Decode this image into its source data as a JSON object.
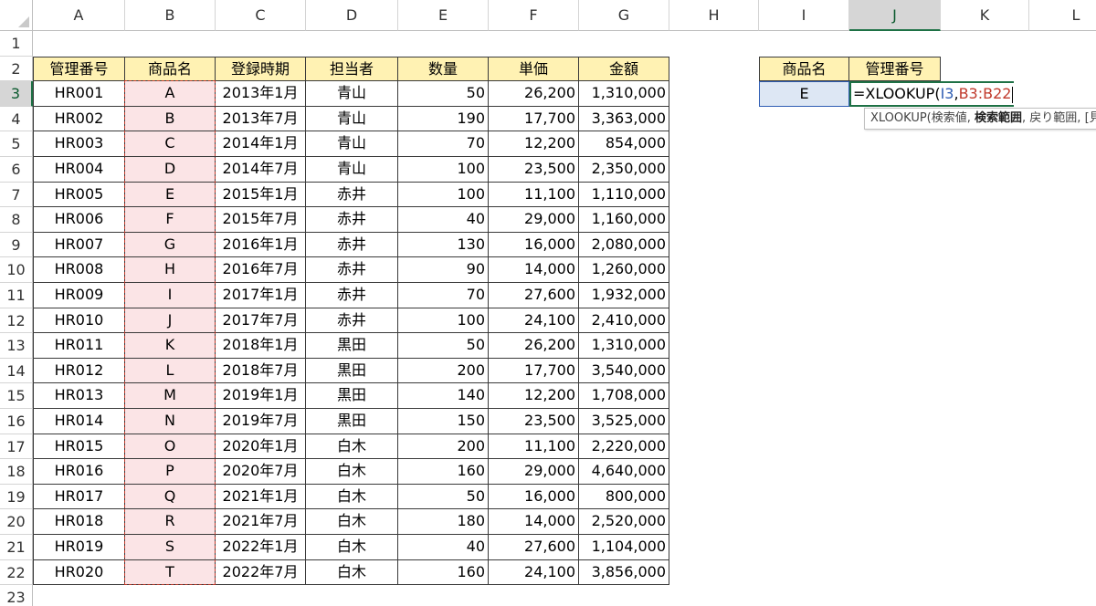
{
  "columns": [
    "A",
    "B",
    "C",
    "D",
    "E",
    "F",
    "G",
    "H",
    "I",
    "J",
    "K",
    "L"
  ],
  "rows": [
    "1",
    "2",
    "3",
    "4",
    "5",
    "6",
    "7",
    "8",
    "9",
    "10",
    "11",
    "12",
    "13",
    "14",
    "15",
    "16",
    "17",
    "18",
    "19",
    "20",
    "21",
    "22",
    "23"
  ],
  "selected_column": "J",
  "selected_row": "3",
  "table": {
    "headers": [
      "管理番号",
      "商品名",
      "登録時期",
      "担当者",
      "数量",
      "単価",
      "金額"
    ],
    "rows": [
      [
        "HR001",
        "A",
        "2013年1月",
        "青山",
        "50",
        "26,200",
        "1,310,000"
      ],
      [
        "HR002",
        "B",
        "2013年7月",
        "青山",
        "190",
        "17,700",
        "3,363,000"
      ],
      [
        "HR003",
        "C",
        "2014年1月",
        "青山",
        "70",
        "12,200",
        "854,000"
      ],
      [
        "HR004",
        "D",
        "2014年7月",
        "青山",
        "100",
        "23,500",
        "2,350,000"
      ],
      [
        "HR005",
        "E",
        "2015年1月",
        "赤井",
        "100",
        "11,100",
        "1,110,000"
      ],
      [
        "HR006",
        "F",
        "2015年7月",
        "赤井",
        "40",
        "29,000",
        "1,160,000"
      ],
      [
        "HR007",
        "G",
        "2016年1月",
        "赤井",
        "130",
        "16,000",
        "2,080,000"
      ],
      [
        "HR008",
        "H",
        "2016年7月",
        "赤井",
        "90",
        "14,000",
        "1,260,000"
      ],
      [
        "HR009",
        "I",
        "2017年1月",
        "赤井",
        "70",
        "27,600",
        "1,932,000"
      ],
      [
        "HR010",
        "J",
        "2017年7月",
        "赤井",
        "100",
        "24,100",
        "2,410,000"
      ],
      [
        "HR011",
        "K",
        "2018年1月",
        "黒田",
        "50",
        "26,200",
        "1,310,000"
      ],
      [
        "HR012",
        "L",
        "2018年7月",
        "黒田",
        "200",
        "17,700",
        "3,540,000"
      ],
      [
        "HR013",
        "M",
        "2019年1月",
        "黒田",
        "140",
        "12,200",
        "1,708,000"
      ],
      [
        "HR014",
        "N",
        "2019年7月",
        "黒田",
        "150",
        "23,500",
        "3,525,000"
      ],
      [
        "HR015",
        "O",
        "2020年1月",
        "白木",
        "200",
        "11,100",
        "2,220,000"
      ],
      [
        "HR016",
        "P",
        "2020年7月",
        "白木",
        "160",
        "29,000",
        "4,640,000"
      ],
      [
        "HR017",
        "Q",
        "2021年1月",
        "白木",
        "50",
        "16,000",
        "800,000"
      ],
      [
        "HR018",
        "R",
        "2021年7月",
        "白木",
        "180",
        "14,000",
        "2,520,000"
      ],
      [
        "HR019",
        "S",
        "2022年1月",
        "白木",
        "40",
        "27,600",
        "1,104,000"
      ],
      [
        "HR020",
        "T",
        "2022年7月",
        "白木",
        "160",
        "24,100",
        "3,856,000"
      ]
    ]
  },
  "lookup": {
    "headers": [
      "商品名",
      "管理番号"
    ],
    "input_value": "E"
  },
  "formula": {
    "prefix": "=XLOOKUP(",
    "arg1": "I3",
    "sep": ",",
    "arg2": "B3:B22"
  },
  "tooltip": {
    "func": "XLOOKUP(",
    "arg1": "検索値, ",
    "arg2_bold": "検索範囲",
    "rest": ", 戻り範囲, [見つからない場合], [一致モード], [検索モード])"
  },
  "colors": {
    "header_fill": "#fff2b3",
    "reference_fill": "#fbe4e6",
    "lookup_fill": "#dde7f4",
    "selection_accent": "#1e7145",
    "ref_blue": "#2f5db3",
    "ref_red": "#c0392b"
  }
}
